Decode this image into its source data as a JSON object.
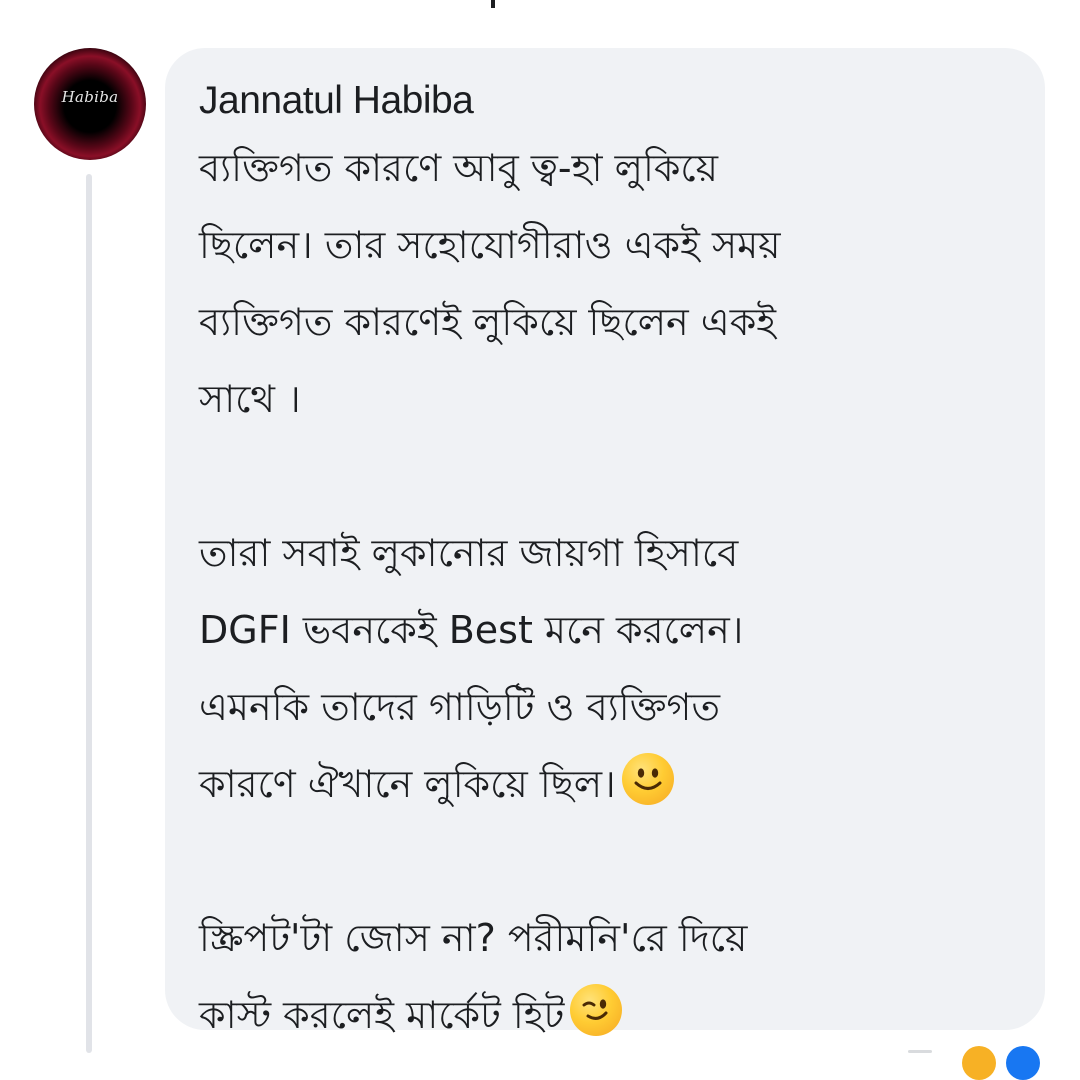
{
  "comment": {
    "author": "Jannatul Habiba",
    "avatar_text": "Habiba",
    "paragraph_1": "ব্যক্তিগত কারণে আবু ত্ব-হা লুকিয়ে\nছিলেন। তার সহোযোগীরাও একই সময়\nব্যক্তিগত কারণেই লুকিয়ে ছিলেন একই\nসাথে ।",
    "paragraph_2": "তারা সবাই লুকানোর জায়গা হিসাবে\nDGFI ভবনকেই Best মনে করলেন।\nএমনকি তাদের গাড়িটি ও ব্যক্তিগত\nকারণে ঐখানে লুকিয়ে ছিল।",
    "paragraph_3": "স্ক্রিপট'টা জোস না? পরীমনি'রে দিয়ে\nকাস্ট করলেই মার্কেট হিট",
    "emoji_1": "slightly-smiling-face-icon",
    "emoji_2": "winking-face-icon"
  },
  "colors": {
    "bubble": "#f0f2f5",
    "text": "#1c1e21",
    "thread_line": "#e1e3e8",
    "reaction_like": "#1877f2",
    "reaction_haha": "#f7b125"
  }
}
